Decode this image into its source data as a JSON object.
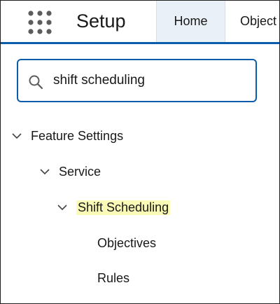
{
  "header": {
    "app_launcher_icon": "app-launcher-grid-icon",
    "title": "Setup",
    "tabs": [
      {
        "label": "Home",
        "active": true
      },
      {
        "label": "Object",
        "active": false
      }
    ],
    "accent_color": "#0b5cab"
  },
  "search": {
    "icon": "search-icon",
    "value": "shift scheduling",
    "placeholder": "Quick Find"
  },
  "tree": {
    "items": [
      {
        "label": "Feature Settings",
        "level": 0,
        "expanded": true
      },
      {
        "label": "Service",
        "level": 1,
        "expanded": true
      },
      {
        "label": "Shift Scheduling",
        "level": 2,
        "expanded": true,
        "highlight_color": "#fbfbb8"
      },
      {
        "label": "Objectives",
        "level": 3
      },
      {
        "label": "Rules",
        "level": 3
      }
    ]
  }
}
